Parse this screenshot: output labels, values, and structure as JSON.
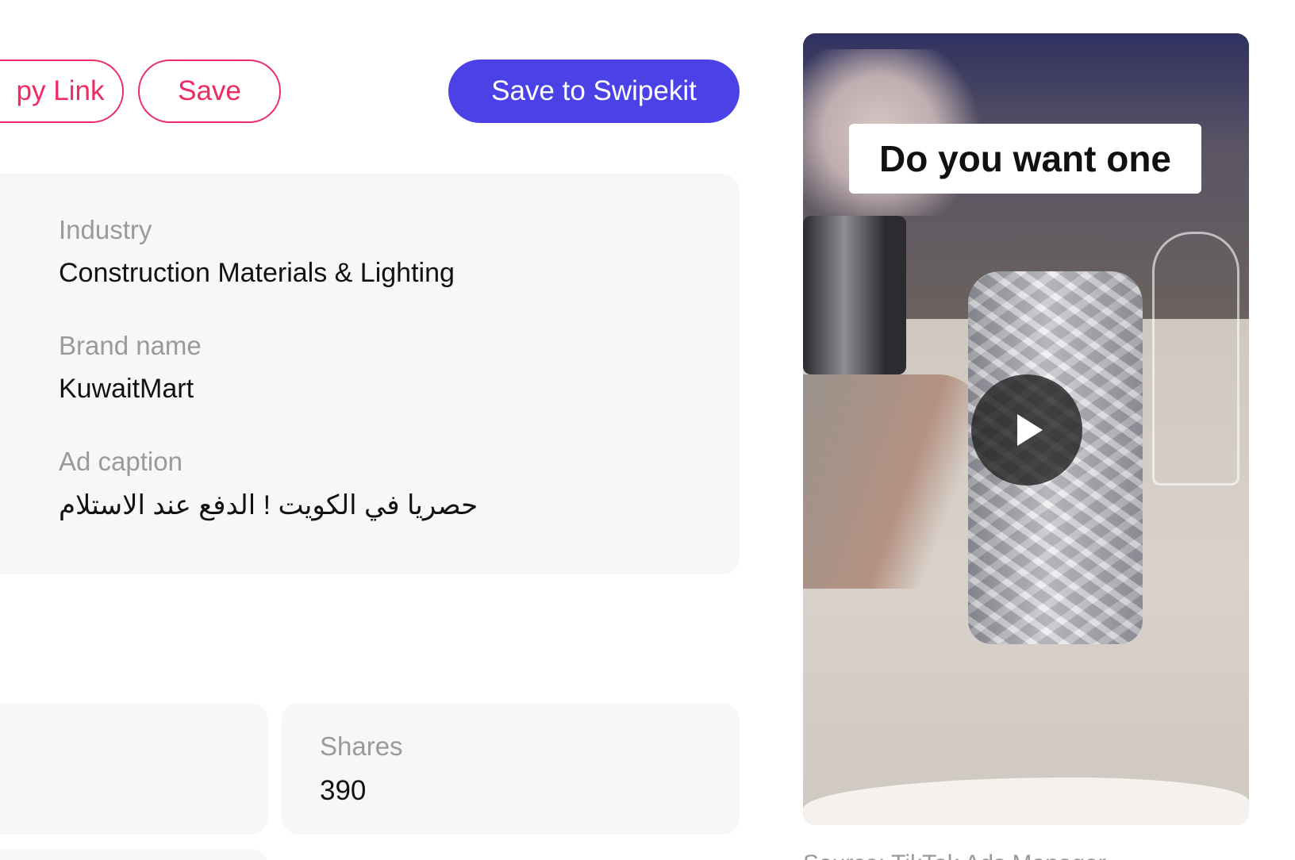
{
  "actions": {
    "copy_link_label": "py Link",
    "save_label": "Save",
    "save_to_swipekit_label": "Save to Swipekit"
  },
  "details": {
    "industry_label": "Industry",
    "industry_value": "Construction Materials & Lighting",
    "brand_label": "Brand name",
    "brand_value": "KuwaitMart",
    "caption_label": "Ad caption",
    "caption_value": "حصريا في الكويت ! الدفع عند الاستلام"
  },
  "stats": {
    "shares_label": "Shares",
    "shares_value": "390"
  },
  "video": {
    "overlay_text": "Do you want one",
    "play_icon": "play-icon"
  },
  "source": {
    "text": "Source: TikTok Ads Manager"
  },
  "colors": {
    "accent_pink": "#ef2b63",
    "primary_blue": "#4a42e6",
    "panel_bg": "#f7f7f7"
  }
}
